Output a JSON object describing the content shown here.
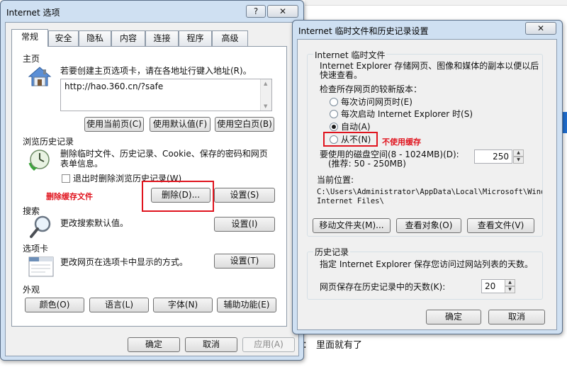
{
  "background": {
    "caption": "里面就有了"
  },
  "options_dialog": {
    "title": "Internet 选项",
    "help_button": "?",
    "close_button": "✕",
    "tabs": [
      {
        "label": "常规"
      },
      {
        "label": "安全"
      },
      {
        "label": "隐私"
      },
      {
        "label": "内容"
      },
      {
        "label": "连接"
      },
      {
        "label": "程序"
      },
      {
        "label": "高级"
      }
    ],
    "home": {
      "section": "主页",
      "description": "若要创建主页选项卡，请在各地址行键入地址(R)。",
      "url": "http://hao.360.cn/?safe",
      "use_current": "使用当前页(C)",
      "use_default": "使用默认值(F)",
      "use_blank": "使用空白页(B)"
    },
    "history": {
      "section": "浏览历史记录",
      "description_line1": "删除临时文件、历史记录、Cookie、保存的密码和网页",
      "description_line2": "表单信息。",
      "delete_on_exit": "退出时删除浏览历史记录(W)",
      "delete_button": "删除(D)...",
      "settings_button": "设置(S)",
      "annotation": "删除缓存文件"
    },
    "search": {
      "section": "搜索",
      "description": "更改搜索默认值。",
      "settings_button": "设置(I)"
    },
    "tabs_section": {
      "section": "选项卡",
      "description": "更改网页在选项卡中显示的方式。",
      "settings_button": "设置(T)"
    },
    "appearance": {
      "section": "外观",
      "colors": "颜色(O)",
      "languages": "语言(L)",
      "fonts": "字体(N)",
      "accessibility": "辅助功能(E)"
    },
    "footer": {
      "ok": "确定",
      "cancel": "取消",
      "apply": "应用(A)"
    }
  },
  "settings_dialog": {
    "title": "Internet 临时文件和历史记录设置",
    "close_button": "✕",
    "temp_files": {
      "group": "Internet 临时文件",
      "description_line1": "Internet Explorer 存储网页、图像和媒体的副本以便以后",
      "description_line2": "快速查看。",
      "check_label": "检查所存网页的较新版本：",
      "options": [
        {
          "label": "每次访问网页时(E)",
          "checked": false
        },
        {
          "label": "每次启动 Internet Explorer 时(S)",
          "checked": false
        },
        {
          "label": "自动(A)",
          "checked": true
        },
        {
          "label": "从不(N)",
          "checked": false
        }
      ],
      "never_annotation": "不使用缓存",
      "disk_space_line1": "要使用的磁盘空间(8 - 1024MB)(D):",
      "disk_space_line2": "(推荐: 50 - 250MB)",
      "disk_space_value": "250",
      "location_label": "当前位置:",
      "location_line1": "C:\\Users\\Administrator\\AppData\\Local\\Microsoft\\Windows\\Temporary",
      "location_line2": "Internet Files\\",
      "move_folder": "移动文件夹(M)...",
      "view_objects": "查看对象(O)",
      "view_files": "查看文件(V)"
    },
    "history": {
      "group": "历史记录",
      "description": "指定 Internet Explorer 保存您访问过网站列表的天数。",
      "days_label": "网页保存在历史记录中的天数(K):",
      "days_value": "20"
    },
    "footer": {
      "ok": "确定",
      "cancel": "取消"
    }
  }
}
